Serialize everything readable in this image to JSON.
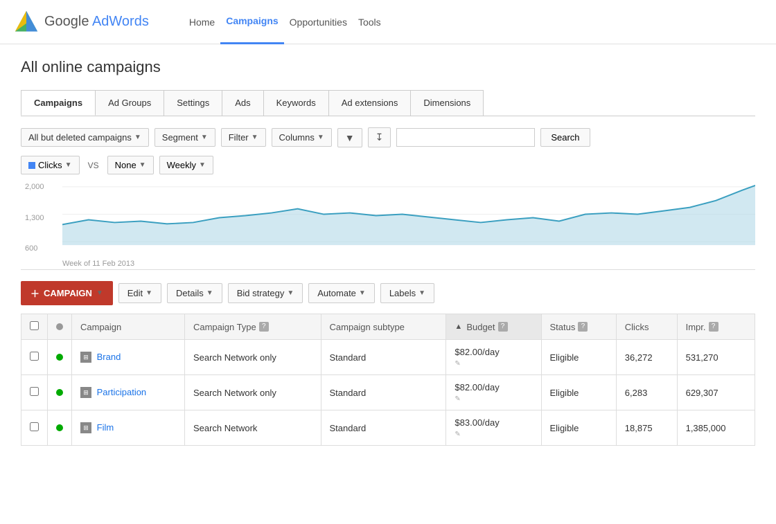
{
  "header": {
    "logo_text": "Google AdWords",
    "nav_items": [
      "Home",
      "Campaigns",
      "Opportunities",
      "Tools"
    ],
    "active_nav": "Campaigns"
  },
  "page": {
    "title": "All online campaigns"
  },
  "tabs": {
    "items": [
      "Campaigns",
      "Ad Groups",
      "Settings",
      "Ads",
      "Keywords",
      "Ad extensions",
      "Dimensions"
    ],
    "active": "Campaigns"
  },
  "toolbar": {
    "filter_label": "All but deleted campaigns",
    "segment_label": "Segment",
    "filter_btn_label": "Filter",
    "columns_label": "Columns",
    "search_placeholder": "",
    "search_label": "Search"
  },
  "chart_controls": {
    "metric1": "Clicks",
    "vs_label": "VS",
    "metric2": "None",
    "period": "Weekly"
  },
  "chart": {
    "y_labels": [
      "2,000",
      "1,300",
      "600"
    ],
    "date_label": "Week of 11 Feb 2013",
    "accent_color": "#4da9c9"
  },
  "action_bar": {
    "campaign_label": "CAMPAIGN",
    "edit_label": "Edit",
    "details_label": "Details",
    "bid_strategy_label": "Bid strategy",
    "automate_label": "Automate",
    "labels_label": "Labels"
  },
  "table": {
    "columns": [
      "",
      "",
      "Campaign",
      "Campaign Type",
      "Campaign subtype",
      "Budget",
      "Status",
      "Clicks",
      "Impr."
    ],
    "rows": [
      {
        "checked": false,
        "status_dot": "green",
        "campaign": "Brand",
        "campaign_type": "Search Network only",
        "campaign_subtype": "Standard",
        "budget": "$82.00/day",
        "status": "Eligible",
        "clicks": "36,272",
        "impr": "531,270"
      },
      {
        "checked": false,
        "status_dot": "green",
        "campaign": "Participation",
        "campaign_type": "Search Network only",
        "campaign_subtype": "Standard",
        "budget": "$82.00/day",
        "status": "Eligible",
        "clicks": "6,283",
        "impr": "629,307"
      },
      {
        "checked": false,
        "status_dot": "green",
        "campaign": "Film",
        "campaign_type": "Search Network",
        "campaign_subtype": "Standard",
        "budget": "$83.00/day",
        "status": "Eligible",
        "clicks": "18,875",
        "impr": "1,385,000"
      }
    ]
  }
}
